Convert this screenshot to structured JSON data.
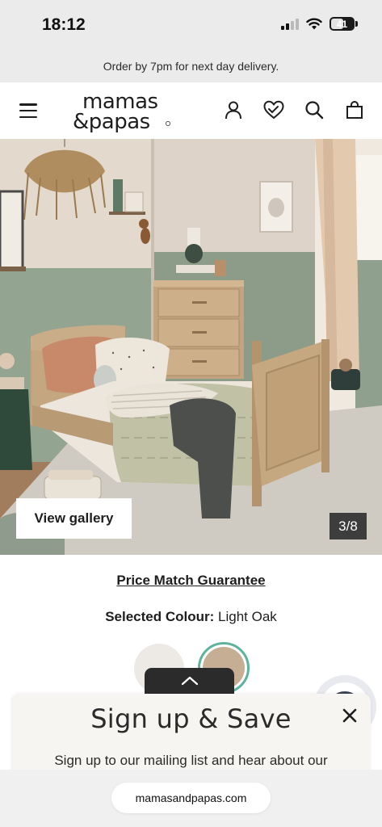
{
  "status_bar": {
    "time": "18:12",
    "battery": "41"
  },
  "promo": {
    "text": "Order by 7pm for next day delivery."
  },
  "header": {
    "logo_line1": "mamas",
    "logo_line2": "&papas",
    "icons": [
      "menu-icon",
      "account-icon",
      "wishlist-heart-icon",
      "search-icon",
      "bag-icon"
    ]
  },
  "gallery": {
    "button_label": "View gallery",
    "counter": "3/8"
  },
  "product": {
    "price_match": "Price Match Guarantee",
    "colour_label": "Selected Colour:",
    "colour_value": "Light Oak",
    "swatches": [
      {
        "name": "White",
        "color": "#edeae6",
        "selected": false
      },
      {
        "name": "Light Oak",
        "color": "#c6ae94",
        "selected": true
      }
    ],
    "swatch_ring_color": "#5fb39c"
  },
  "signup": {
    "title": "Sign up & Save",
    "text": "Sign up to our mailing list and hear about our"
  },
  "browser": {
    "url": "mamasandpapas.com"
  }
}
